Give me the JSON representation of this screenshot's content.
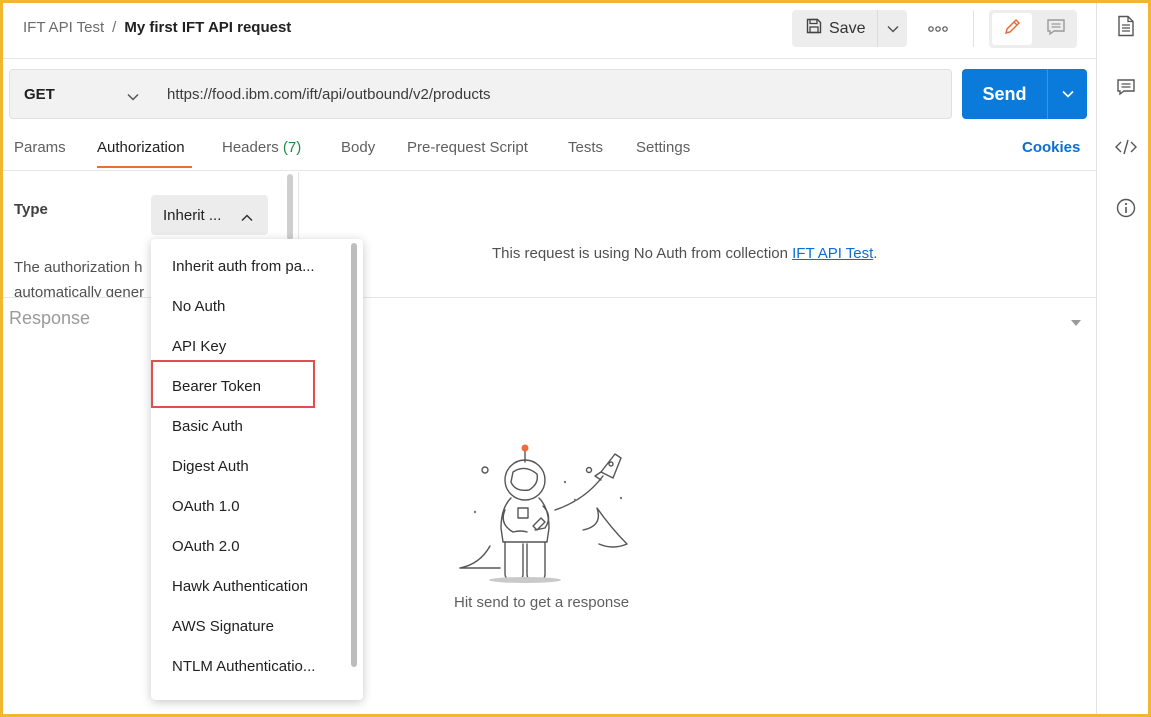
{
  "header": {
    "breadcrumb_parent": "IFT API Test",
    "breadcrumb_separator": "/",
    "breadcrumb_current": "My first IFT API request",
    "save_label": "Save"
  },
  "request": {
    "method": "GET",
    "url": "https://food.ibm.com/ift/api/outbound/v2/products",
    "send_label": "Send"
  },
  "tabs": [
    {
      "label": "Params"
    },
    {
      "label": "Authorization",
      "active": true
    },
    {
      "label": "Headers",
      "count": "(7)"
    },
    {
      "label": "Body"
    },
    {
      "label": "Pre-request Script"
    },
    {
      "label": "Tests"
    },
    {
      "label": "Settings"
    }
  ],
  "cookies_label": "Cookies",
  "auth": {
    "type_label": "Type",
    "selected_type": "Inherit ...",
    "description_line1": "The authorization h",
    "description_line2": "automatically gener",
    "message_prefix": "This request is using No Auth from collection ",
    "message_link": "IFT API Test",
    "message_suffix": "."
  },
  "auth_type_options": [
    "Inherit auth from pa...",
    "No Auth",
    "API Key",
    "Bearer Token",
    "Basic Auth",
    "Digest Auth",
    "OAuth 1.0",
    "OAuth 2.0",
    "Hawk Authentication",
    "AWS Signature",
    "NTLM Authenticatio..."
  ],
  "highlighted_option": "Bearer Token",
  "response": {
    "title": "Response",
    "hint": "Hit send to get a response"
  },
  "colors": {
    "accent_send": "#0b7bdb",
    "active_tab_underline": "#ef6c3a",
    "highlight_box": "#e34d4d",
    "frame": "#f0b731",
    "headers_count": "#1e8a45"
  },
  "icons": {
    "save": "save-icon",
    "more": "more-options-icon",
    "edit": "pencil-icon",
    "comment": "comment-icon",
    "sidebar": [
      "documentation-icon",
      "comments-icon",
      "code-icon",
      "info-icon"
    ]
  }
}
